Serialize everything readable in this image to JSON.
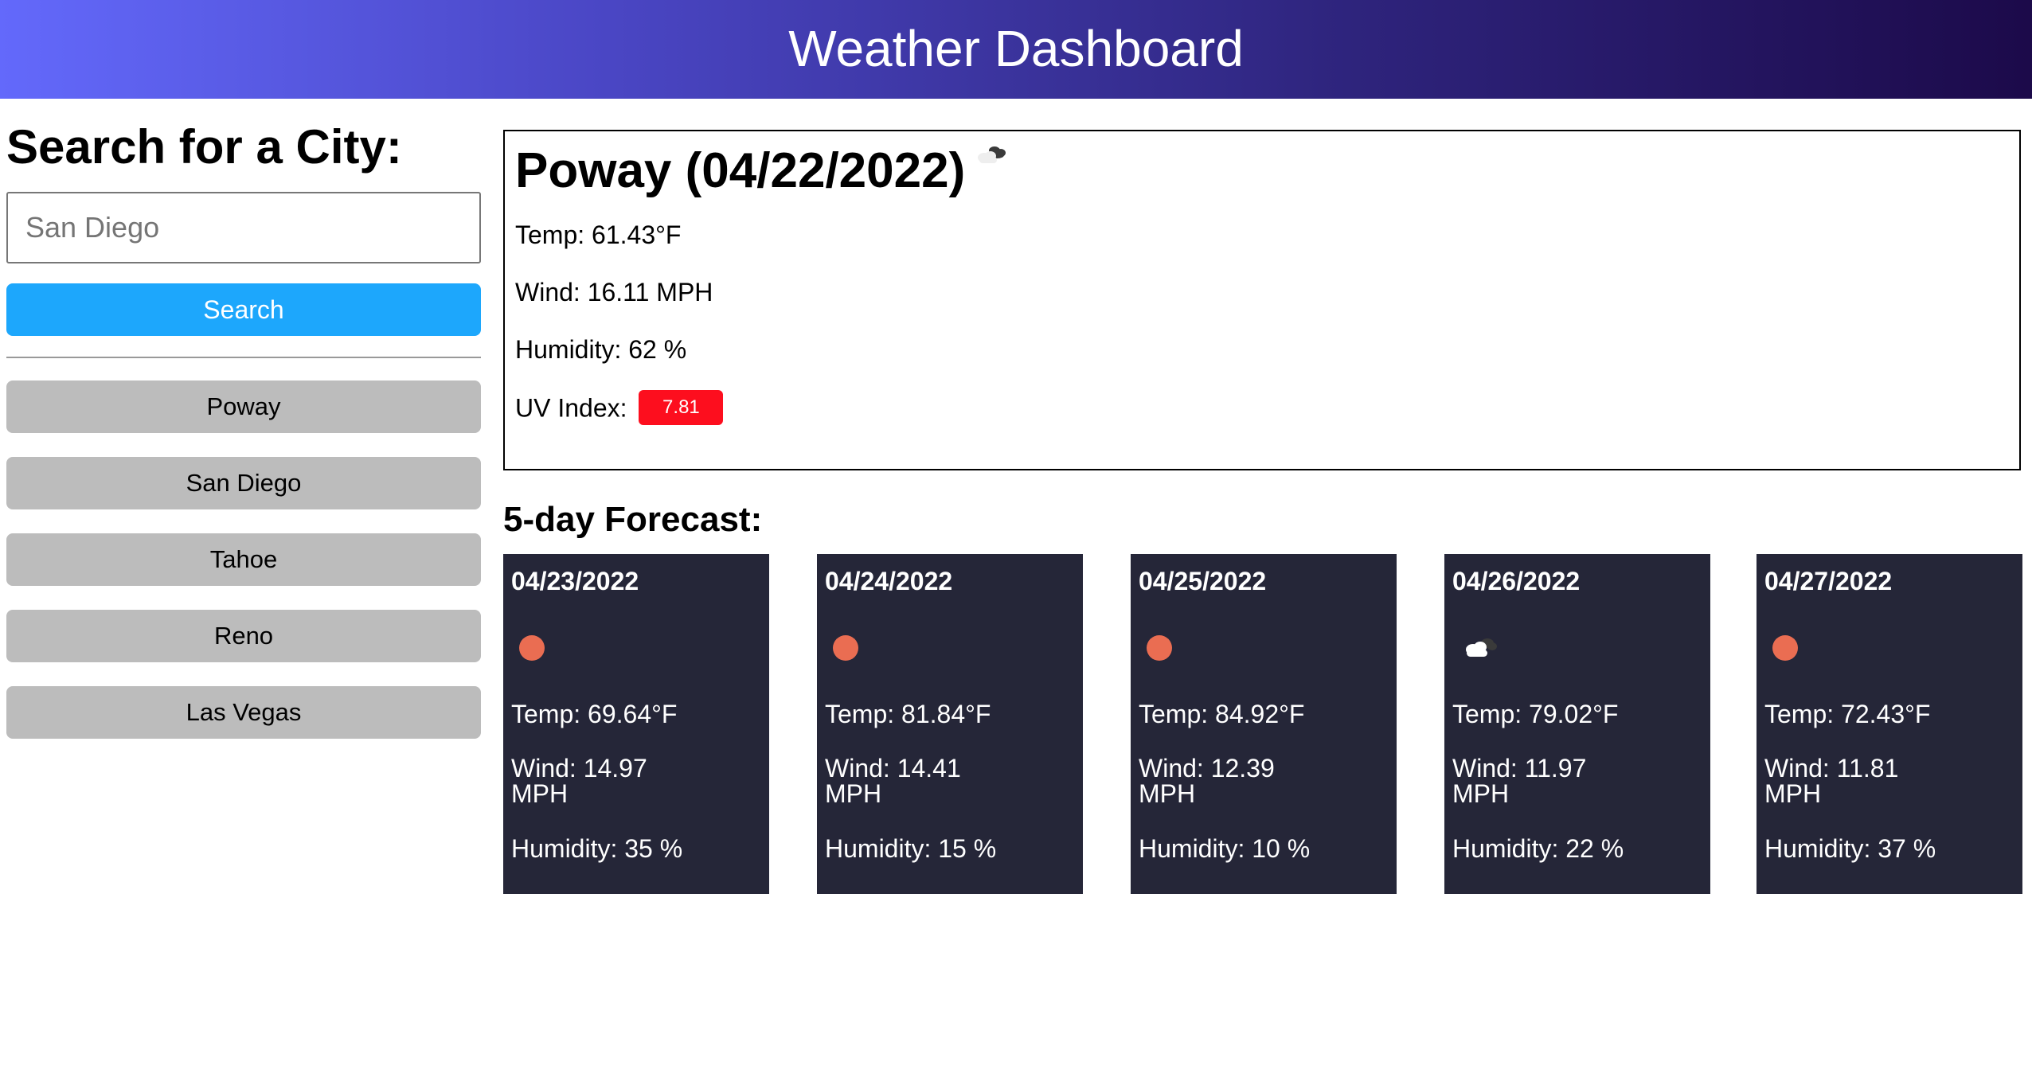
{
  "header": {
    "title": "Weather Dashboard"
  },
  "sidebar": {
    "heading": "Search for a City:",
    "search": {
      "value": "",
      "placeholder": "San Diego"
    },
    "search_button": "Search",
    "history": [
      "Poway",
      "San Diego",
      "Tahoe",
      "Reno",
      "Las Vegas"
    ]
  },
  "current": {
    "title": "Poway (04/22/2022)",
    "icon": "partly-cloudy-icon",
    "temp": "Temp: 61.43°F",
    "wind": "Wind: 16.11 MPH",
    "humidity": "Humidity: 62 %",
    "uv_label": "UV Index:",
    "uv_value": "7.81",
    "uv_color": "#fd0e1e"
  },
  "forecast": {
    "title": "5-day Forecast:",
    "days": [
      {
        "date": "04/23/2022",
        "icon": "sun-icon",
        "temp": "Temp: 69.64°F",
        "wind": "Wind: 14.97 MPH",
        "humidity": "Humidity: 35 %"
      },
      {
        "date": "04/24/2022",
        "icon": "sun-icon",
        "temp": "Temp: 81.84°F",
        "wind": "Wind: 14.41 MPH",
        "humidity": "Humidity: 15 %"
      },
      {
        "date": "04/25/2022",
        "icon": "sun-icon",
        "temp": "Temp: 84.92°F",
        "wind": "Wind: 12.39 MPH",
        "humidity": "Humidity: 10 %"
      },
      {
        "date": "04/26/2022",
        "icon": "cloud-icon",
        "temp": "Temp: 79.02°F",
        "wind": "Wind: 11.97 MPH",
        "humidity": "Humidity: 22 %"
      },
      {
        "date": "04/27/2022",
        "icon": "sun-icon",
        "temp": "Temp: 72.43°F",
        "wind": "Wind: 11.81 MPH",
        "humidity": "Humidity: 37 %"
      }
    ]
  },
  "colors": {
    "header_gradient_start": "#6369fb",
    "header_gradient_end": "#1c0a4a",
    "search_button": "#1da7fc",
    "history_button": "#bcbcbc",
    "forecast_card": "#252638",
    "sun": "#ea6d52"
  }
}
